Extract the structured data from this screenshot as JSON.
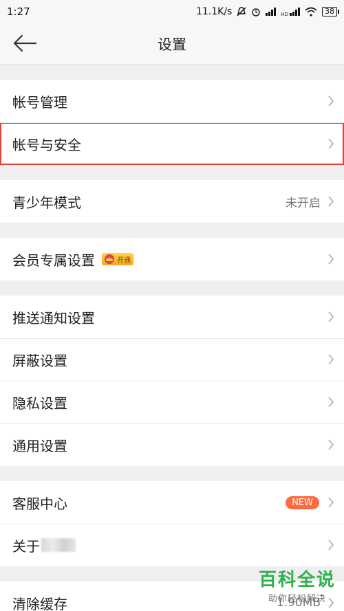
{
  "status": {
    "time": "1:27",
    "speed": "11.1K/s",
    "network_hd": "HD",
    "battery": "38"
  },
  "header": {
    "title": "设置"
  },
  "groups": [
    {
      "items": [
        {
          "label": "帐号管理"
        },
        {
          "label": "帐号与安全"
        }
      ]
    },
    {
      "items": [
        {
          "label": "青少年模式",
          "value": "未开启"
        }
      ]
    },
    {
      "items": [
        {
          "label": "会员专属设置",
          "badge": "开通"
        }
      ]
    },
    {
      "items": [
        {
          "label": "推送通知设置"
        },
        {
          "label": "屏蔽设置"
        },
        {
          "label": "隐私设置"
        },
        {
          "label": "通用设置"
        }
      ]
    },
    {
      "items": [
        {
          "label": "客服中心",
          "badge": "NEW"
        },
        {
          "label": "关于"
        }
      ]
    },
    {
      "items": [
        {
          "label": "清除缓存",
          "value": "1.90MB"
        }
      ]
    }
  ],
  "watermark": {
    "title": "百科全说",
    "subtitle": "助你轻松解决"
  },
  "colors": {
    "highlight": "#e0443a",
    "new_badge": "#ff6a3d",
    "watermark": "#2fb14c"
  }
}
